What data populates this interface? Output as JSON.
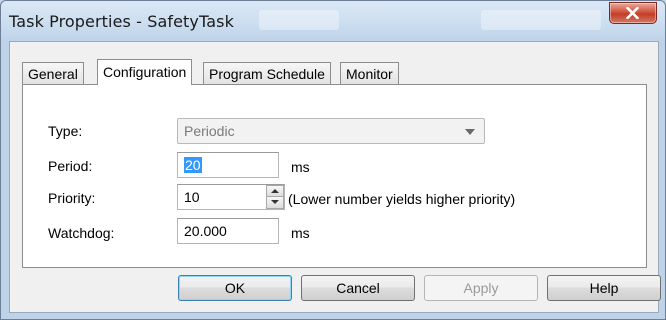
{
  "window": {
    "title": "Task Properties - SafetyTask"
  },
  "tabs": [
    {
      "label": "General",
      "active": false
    },
    {
      "label": "Configuration",
      "active": true
    },
    {
      "label": "Program Schedule",
      "active": false
    },
    {
      "label": "Monitor",
      "active": false
    }
  ],
  "form": {
    "type": {
      "label": "Type:",
      "value": "Periodic"
    },
    "period": {
      "label": "Period:",
      "value": "20",
      "unit": "ms"
    },
    "priority": {
      "label": "Priority:",
      "value": "10",
      "hint": "(Lower number yields higher priority)"
    },
    "watchdog": {
      "label": "Watchdog:",
      "value": "20.000",
      "unit": "ms"
    }
  },
  "buttons": {
    "ok": "OK",
    "cancel": "Cancel",
    "apply": "Apply",
    "help": "Help"
  },
  "icons": {
    "close": "close-icon",
    "dropdown": "chevron-down-icon",
    "spin_up": "arrow-up-icon",
    "spin_down": "arrow-down-icon"
  },
  "colors": {
    "close_button": "#c8442f",
    "selection": "#3399ff",
    "default_button_border": "#3c7fb1"
  }
}
